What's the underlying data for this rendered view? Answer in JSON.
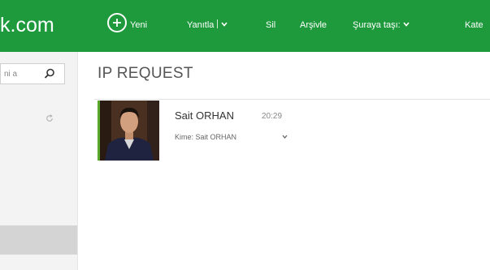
{
  "header": {
    "brand": "k.com",
    "commands": {
      "new": "Yeni",
      "reply": "Yanıtla",
      "delete": "Sil",
      "archive": "Arşivle",
      "move_to": "Şuraya taşı:",
      "categories": "Kate"
    },
    "background_color": "#1e9a3d"
  },
  "sidebar": {
    "search": {
      "value": "ni a",
      "icon": "search-icon"
    },
    "refresh_icon": "refresh-icon"
  },
  "message": {
    "title": "IP REQUEST",
    "sender": "Sait ORHAN",
    "time": "20:29",
    "to_label": "Kime: Sait ORHAN",
    "accent_color": "#5aa829"
  }
}
